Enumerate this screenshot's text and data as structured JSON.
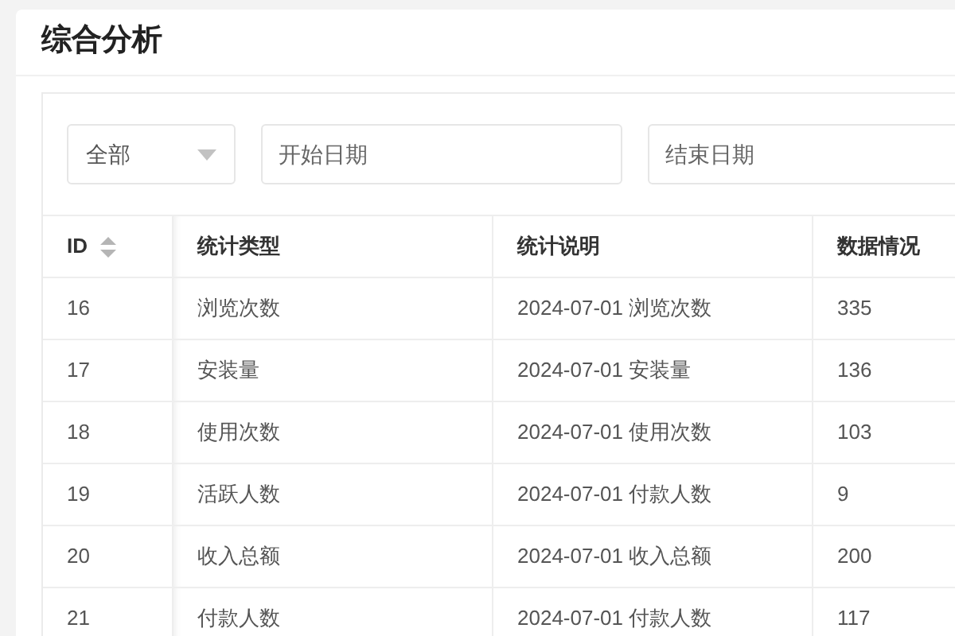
{
  "page": {
    "title": "综合分析"
  },
  "filters": {
    "type_select": {
      "value": "全部"
    },
    "start_date": {
      "placeholder": "开始日期"
    },
    "end_date": {
      "placeholder": "结束日期"
    }
  },
  "table": {
    "columns": [
      "ID",
      "统计类型",
      "统计说明",
      "数据情况"
    ],
    "rows": [
      [
        "16",
        "浏览次数",
        "2024-07-01 浏览次数",
        "335"
      ],
      [
        "17",
        "安装量",
        "2024-07-01 安装量",
        "136"
      ],
      [
        "18",
        "使用次数",
        "2024-07-01 使用次数",
        "103"
      ],
      [
        "19",
        "活跃人数",
        "2024-07-01 付款人数",
        "9"
      ],
      [
        "20",
        "收入总额",
        "2024-07-01 收入总额",
        "200"
      ],
      [
        "21",
        "付款人数",
        "2024-07-01 付款人数",
        "117"
      ]
    ]
  }
}
